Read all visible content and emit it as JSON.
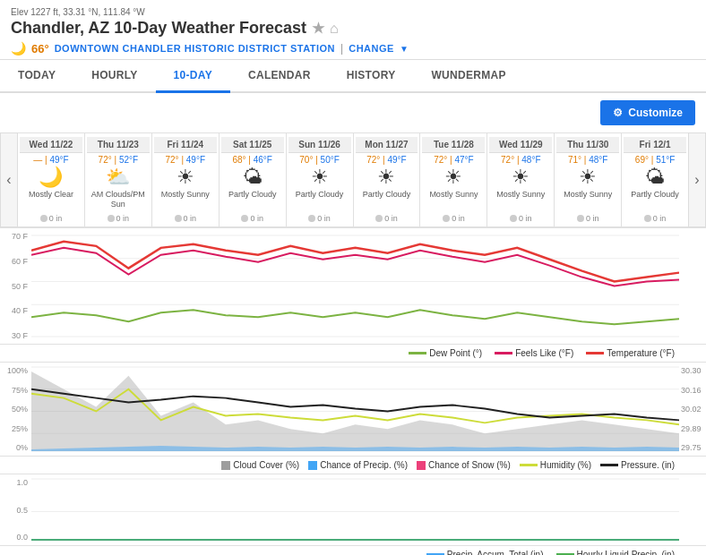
{
  "header": {
    "title": "Chandler, AZ 10-Day Weather Forecast",
    "elevation": "Elev 1227 ft, 33.31 °N, 111.84 °W",
    "temperature": "66°",
    "location_name": "DOWNTOWN CHANDLER HISTORIC DISTRICT STATION",
    "change_label": "CHANGE",
    "star_icon": "★",
    "home_icon": "⌂"
  },
  "nav": {
    "tabs": [
      {
        "label": "TODAY",
        "active": false
      },
      {
        "label": "HOURLY",
        "active": false
      },
      {
        "label": "10-DAY",
        "active": true
      },
      {
        "label": "CALENDAR",
        "active": false
      },
      {
        "label": "HISTORY",
        "active": false
      },
      {
        "label": "WUNDERMAP",
        "active": false
      }
    ]
  },
  "toolbar": {
    "customize_label": "Customize"
  },
  "days": [
    {
      "date": "Wed 11/22",
      "high": "—",
      "low": "49°F",
      "icon": "🌙",
      "desc": "Mostly Clear",
      "precip": "0 in"
    },
    {
      "date": "Thu 11/23",
      "high": "72°",
      "low": "52°F",
      "icon": "⛅",
      "desc": "AM Clouds/PM Sun",
      "precip": "0 in"
    },
    {
      "date": "Fri 11/24",
      "high": "72°",
      "low": "49°F",
      "icon": "☀",
      "desc": "Mostly Sunny",
      "precip": "0 in"
    },
    {
      "date": "Sat 11/25",
      "high": "68°",
      "low": "46°F",
      "icon": "🌤",
      "desc": "Partly Cloudy",
      "precip": "0 in"
    },
    {
      "date": "Sun 11/26",
      "high": "70°",
      "low": "50°F",
      "icon": "☀",
      "desc": "Partly Cloudy",
      "precip": "0 in"
    },
    {
      "date": "Mon 11/27",
      "high": "72°",
      "low": "49°F",
      "icon": "☀",
      "desc": "Partly Cloudy",
      "precip": "0 in"
    },
    {
      "date": "Tue 11/28",
      "high": "72°",
      "low": "47°F",
      "icon": "☀",
      "desc": "Mostly Sunny",
      "precip": "0 in"
    },
    {
      "date": "Wed 11/29",
      "high": "72°",
      "low": "48°F",
      "icon": "☀",
      "desc": "Mostly Sunny",
      "precip": "0 in"
    },
    {
      "date": "Thu 11/30",
      "high": "71°",
      "low": "48°F",
      "icon": "☀",
      "desc": "Mostly Sunny",
      "precip": "0 in"
    },
    {
      "date": "Fri 12/1",
      "high": "69°",
      "low": "51°F",
      "icon": "🌤",
      "desc": "Partly Cloudy",
      "precip": "0 in"
    }
  ],
  "chart1": {
    "y_labels": [
      "70 F",
      "60 F",
      "50 F",
      "40 F",
      "30 F"
    ],
    "legend": [
      {
        "label": "Dew Point (°)",
        "color": "#7cb342"
      },
      {
        "label": "Feels Like (°F)",
        "color": "#d81b60"
      },
      {
        "label": "Temperature (°F)",
        "color": "#e53935"
      }
    ]
  },
  "chart2": {
    "y_labels": [
      "100%",
      "75%",
      "50%",
      "25%",
      "0%"
    ],
    "y_labels_right": [
      "30.30",
      "30.16",
      "30.02",
      "29.89",
      "29.75"
    ],
    "legend": [
      {
        "label": "Cloud Cover (%)",
        "color": "#9e9e9e"
      },
      {
        "label": "Chance of Precip. (%)",
        "color": "#42a5f5"
      },
      {
        "label": "Chance of Snow (%)",
        "color": "#ec407a"
      },
      {
        "label": "Humidity (%)",
        "color": "#cddc39"
      },
      {
        "label": "Pressure. (in)",
        "color": "#212121"
      }
    ]
  },
  "chart3": {
    "y_labels": [
      "1.0",
      "0.5",
      "0.0"
    ],
    "legend": [
      {
        "label": "Precip. Accum. Total (in)",
        "color": "#42a5f5"
      },
      {
        "label": "Hourly Liquid Precip. (in)",
        "color": "#4caf50"
      }
    ]
  }
}
